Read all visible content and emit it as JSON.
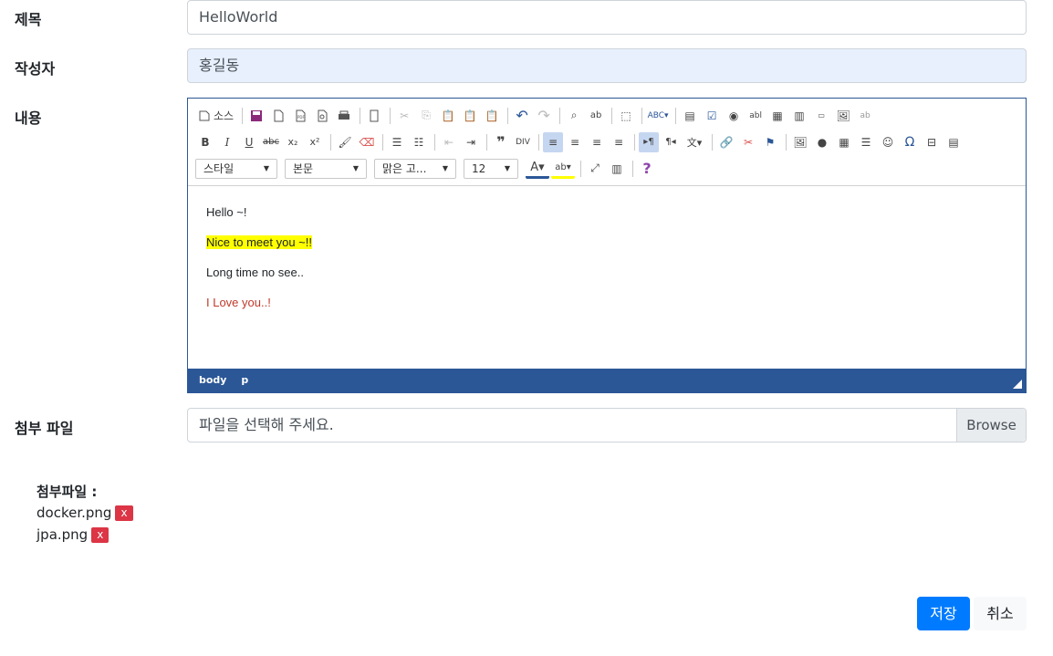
{
  "form": {
    "title_label": "제목",
    "title_value": "HelloWorld",
    "author_label": "작성자",
    "author_value": "홍길동",
    "content_label": "내용",
    "attach_label": "첨부 파일",
    "file_placeholder": "파일을 선택해 주세요.",
    "browse_label": "Browse"
  },
  "editor": {
    "source_label": "소스",
    "combos": {
      "style": "스타일",
      "format": "본문",
      "font": "맑은 고...",
      "size": "12"
    },
    "lines": {
      "line1": "Hello ~!",
      "line2": "Nice to meet you ~!!",
      "line3": "Long time no see..",
      "line4": "I Love you..!"
    },
    "highlight_color": "#ffff00",
    "red_text_color": "#c0392b",
    "status_path": [
      "body",
      "p"
    ]
  },
  "attachments": {
    "title": "첨부파일 :",
    "files": [
      {
        "name": "docker.png",
        "remove": "x"
      },
      {
        "name": "jpa.png",
        "remove": "x"
      }
    ]
  },
  "actions": {
    "save": "저장",
    "cancel": "취소"
  },
  "colors": {
    "primary": "#007bff",
    "editor_border": "#2b5797",
    "danger": "#dc3545"
  }
}
